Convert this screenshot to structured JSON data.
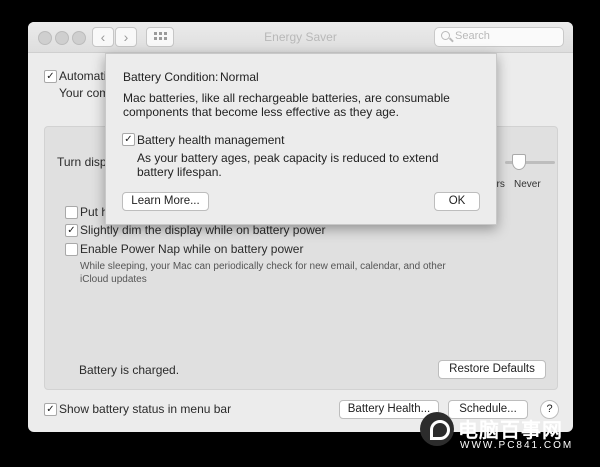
{
  "window": {
    "title": "Energy Saver",
    "search_placeholder": "Search"
  },
  "main": {
    "auto_graphics_label_visible": "Automatic",
    "auto_graphics_sub_visible": "Your com",
    "turn_display_label_visible": "Turn displ",
    "slider_end_labels": [
      "hrs",
      "Never"
    ],
    "put_hd_label_visible": "Put h",
    "dim_display_label": "Slightly dim the display while on battery power",
    "power_nap_label": "Enable Power Nap while on battery power",
    "power_nap_desc_line1": "While sleeping, your Mac can periodically check for new email, calendar, and other",
    "power_nap_desc_line2": "iCloud updates",
    "battery_status": "Battery is charged.",
    "restore_defaults_label": "Restore Defaults",
    "show_battery_label": "Show battery status in menu bar",
    "battery_health_button": "Battery Health...",
    "schedule_button": "Schedule...",
    "help_button": "?"
  },
  "sheet": {
    "condition_label": "Battery Condition:",
    "condition_value": "Normal",
    "desc_line1": "Mac batteries, like all rechargeable batteries, are consumable",
    "desc_line2": "components that become less effective as they age.",
    "health_mgmt_label": "Battery health management",
    "health_desc_line1": "As your battery ages, peak capacity is reduced to extend",
    "health_desc_line2": "battery lifespan.",
    "learn_more_label": "Learn More...",
    "ok_label": "OK"
  },
  "watermark": {
    "name": "电脑百事网",
    "url": "WWW.PC841.COM"
  }
}
